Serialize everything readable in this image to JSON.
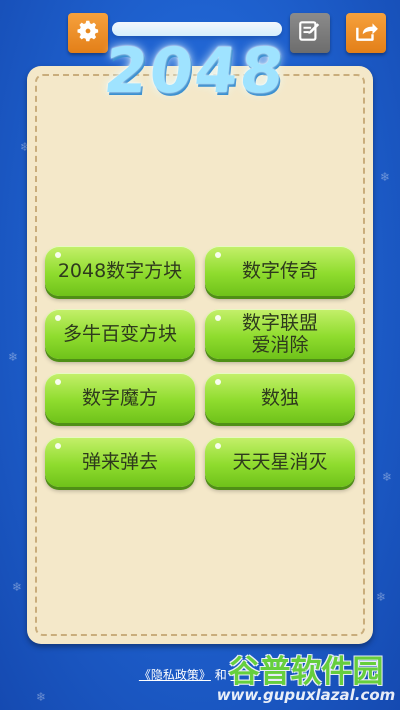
{
  "app": {
    "logo_text": "2048"
  },
  "toolbar": {
    "settings_icon": "gear-icon",
    "edit_icon": "edit-note-icon",
    "share_icon": "share-icon"
  },
  "games": [
    {
      "label": "2048数字方块"
    },
    {
      "label": "数字传奇"
    },
    {
      "label": "多牛百变方块"
    },
    {
      "label": "数字联盟\n爱消除"
    },
    {
      "label": "数字魔方"
    },
    {
      "label": "数独"
    },
    {
      "label": "弹来弹去"
    },
    {
      "label": "天天星消灭"
    }
  ],
  "footer": {
    "privacy_link": "《隐私政策》",
    "and_text": "和"
  },
  "watermark": {
    "title": "谷普软件园",
    "url": "www.gupuxlazal.com"
  },
  "colors": {
    "background": "#1f62d0",
    "panel": "#f4e8c9",
    "button_green": "#8fdc2e",
    "toolbar_orange": "#e37f18",
    "toolbar_gray": "#6d6d6d"
  }
}
